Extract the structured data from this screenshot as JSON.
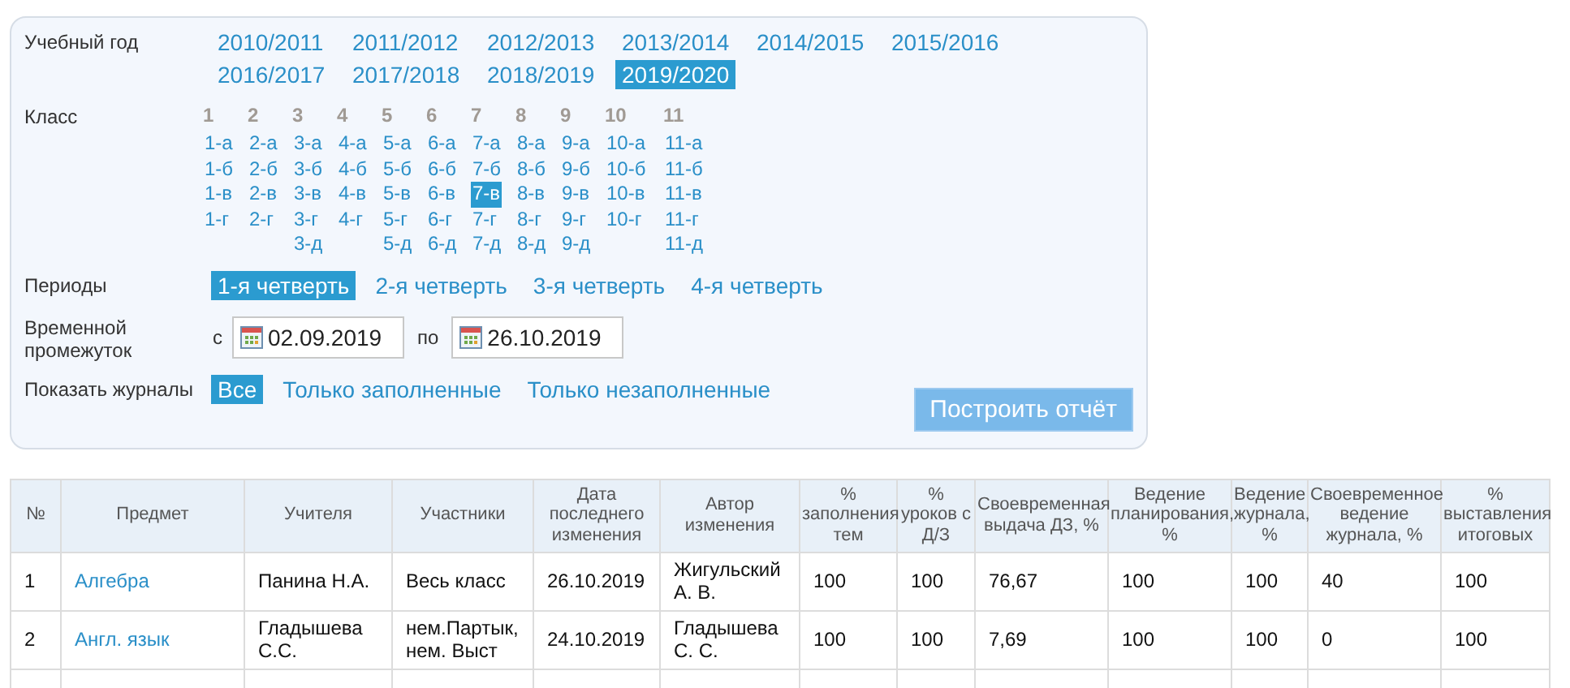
{
  "filters": {
    "year": {
      "label": "Учебный год",
      "options": [
        {
          "label": "2010/2011",
          "selected": false
        },
        {
          "label": "2011/2012",
          "selected": false
        },
        {
          "label": "2012/2013",
          "selected": false
        },
        {
          "label": "2013/2014",
          "selected": false
        },
        {
          "label": "2014/2015",
          "selected": false
        },
        {
          "label": "2015/2016",
          "selected": false
        },
        {
          "label": "2016/2017",
          "selected": false
        },
        {
          "label": "2017/2018",
          "selected": false
        },
        {
          "label": "2018/2019",
          "selected": false
        },
        {
          "label": "2019/2020",
          "selected": true
        }
      ]
    },
    "class": {
      "label": "Класс",
      "grades": [
        {
          "grade": "1",
          "classes": [
            {
              "label": "1-а",
              "selected": false
            },
            {
              "label": "1-б",
              "selected": false
            },
            {
              "label": "1-в",
              "selected": false
            },
            {
              "label": "1-г",
              "selected": false
            }
          ]
        },
        {
          "grade": "2",
          "classes": [
            {
              "label": "2-а",
              "selected": false
            },
            {
              "label": "2-б",
              "selected": false
            },
            {
              "label": "2-в",
              "selected": false
            },
            {
              "label": "2-г",
              "selected": false
            }
          ]
        },
        {
          "grade": "3",
          "classes": [
            {
              "label": "3-а",
              "selected": false
            },
            {
              "label": "3-б",
              "selected": false
            },
            {
              "label": "3-в",
              "selected": false
            },
            {
              "label": "3-г",
              "selected": false
            },
            {
              "label": "3-д",
              "selected": false
            }
          ]
        },
        {
          "grade": "4",
          "classes": [
            {
              "label": "4-а",
              "selected": false
            },
            {
              "label": "4-б",
              "selected": false
            },
            {
              "label": "4-в",
              "selected": false
            },
            {
              "label": "4-г",
              "selected": false
            }
          ]
        },
        {
          "grade": "5",
          "classes": [
            {
              "label": "5-а",
              "selected": false
            },
            {
              "label": "5-б",
              "selected": false
            },
            {
              "label": "5-в",
              "selected": false
            },
            {
              "label": "5-г",
              "selected": false
            },
            {
              "label": "5-д",
              "selected": false
            }
          ]
        },
        {
          "grade": "6",
          "classes": [
            {
              "label": "6-а",
              "selected": false
            },
            {
              "label": "6-б",
              "selected": false
            },
            {
              "label": "6-в",
              "selected": false
            },
            {
              "label": "6-г",
              "selected": false
            },
            {
              "label": "6-д",
              "selected": false
            }
          ]
        },
        {
          "grade": "7",
          "classes": [
            {
              "label": "7-а",
              "selected": false
            },
            {
              "label": "7-б",
              "selected": false
            },
            {
              "label": "7-в",
              "selected": true
            },
            {
              "label": "7-г",
              "selected": false
            },
            {
              "label": "7-д",
              "selected": false
            }
          ]
        },
        {
          "grade": "8",
          "classes": [
            {
              "label": "8-а",
              "selected": false
            },
            {
              "label": "8-б",
              "selected": false
            },
            {
              "label": "8-в",
              "selected": false
            },
            {
              "label": "8-г",
              "selected": false
            },
            {
              "label": "8-д",
              "selected": false
            }
          ]
        },
        {
          "grade": "9",
          "classes": [
            {
              "label": "9-а",
              "selected": false
            },
            {
              "label": "9-б",
              "selected": false
            },
            {
              "label": "9-в",
              "selected": false
            },
            {
              "label": "9-г",
              "selected": false
            },
            {
              "label": "9-д",
              "selected": false
            }
          ]
        },
        {
          "grade": "10",
          "classes": [
            {
              "label": "10-а",
              "selected": false
            },
            {
              "label": "10-б",
              "selected": false
            },
            {
              "label": "10-в",
              "selected": false
            },
            {
              "label": "10-г",
              "selected": false
            }
          ]
        },
        {
          "grade": "11",
          "classes": [
            {
              "label": "11-а",
              "selected": false
            },
            {
              "label": "11-б",
              "selected": false
            },
            {
              "label": "11-в",
              "selected": false
            },
            {
              "label": "11-г",
              "selected": false
            },
            {
              "label": "11-д",
              "selected": false
            }
          ]
        }
      ]
    },
    "periods": {
      "label": "Периоды",
      "options": [
        {
          "label": "1-я четверть",
          "selected": true
        },
        {
          "label": "2-я четверть",
          "selected": false
        },
        {
          "label": "3-я четверть",
          "selected": false
        },
        {
          "label": "4-я четверть",
          "selected": false
        }
      ]
    },
    "range": {
      "label": "Временной промежуток",
      "from_label": "с",
      "from": "02.09.2019",
      "to_label": "по",
      "to": "26.10.2019"
    },
    "journals": {
      "label": "Показать журналы",
      "options": [
        {
          "label": "Все",
          "selected": true
        },
        {
          "label": "Только заполненные",
          "selected": false
        },
        {
          "label": "Только незаполненные",
          "selected": false
        }
      ]
    },
    "submit": "Построить отчёт"
  },
  "table": {
    "columns": [
      "№",
      "Предмет",
      "Учителя",
      "Участники",
      "Дата последнего изменения",
      "Автор изменения",
      "% заполнения тем",
      "% уроков с Д/З",
      "Своевременная выдача ДЗ, %",
      "Ведение планирования, %",
      "Ведение журнала, %",
      "Своевременное ведение журнала, %",
      "% выставления итоговых"
    ],
    "rows": [
      [
        "1",
        "Алгебра",
        "Панина Н.А.",
        "Весь класс",
        "26.10.2019",
        "Жигульский А. В.",
        "100",
        "100",
        "76,67",
        "100",
        "100",
        "40",
        "100"
      ],
      [
        "2",
        "Англ. язык",
        "Гладышева С.С.",
        "нем.Партык, нем. Выст",
        "24.10.2019",
        "Гладышева С. С.",
        "100",
        "100",
        "7,69",
        "100",
        "100",
        "0",
        "100"
      ]
    ]
  }
}
